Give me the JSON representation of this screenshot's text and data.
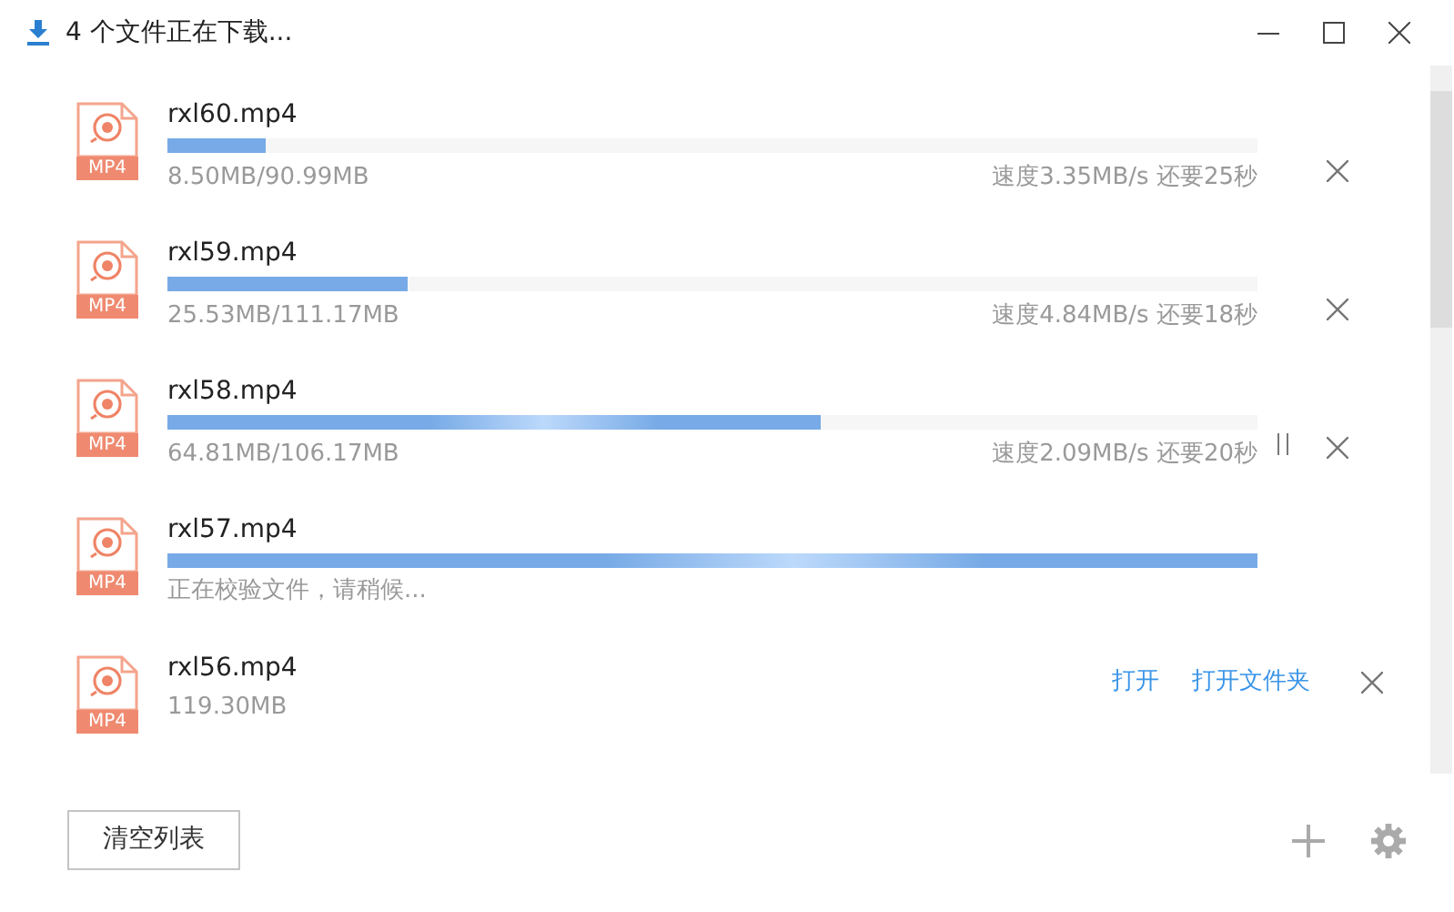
{
  "window": {
    "title": "4 个文件正在下载..."
  },
  "downloads": [
    {
      "kind": "downloading",
      "name": "rxl60.mp4",
      "badge": "MP4",
      "level": 0.09,
      "size": "8.50MB/90.99MB",
      "speed": "速度3.35MB/s 还要25秒",
      "shimmer": false,
      "pause_shown": false
    },
    {
      "kind": "downloading",
      "name": "rxl59.mp4",
      "badge": "MP4",
      "level": 0.22,
      "size": "25.53MB/111.17MB",
      "speed": "速度4.84MB/s 还要18秒",
      "shimmer": false,
      "pause_shown": false
    },
    {
      "kind": "downloading",
      "name": "rxl58.mp4",
      "badge": "MP4",
      "level": 0.6,
      "size": "64.81MB/106.17MB",
      "speed": "速度2.09MB/s 还要20秒",
      "shimmer": true,
      "pause_shown": true
    },
    {
      "kind": "verifying",
      "name": "rxl57.mp4",
      "badge": "MP4",
      "status": "正在校验文件，请稍候...",
      "shimmer": true
    },
    {
      "kind": "done",
      "name": "rxl56.mp4",
      "badge": "MP4",
      "size": "119.30MB",
      "open": "打开",
      "open_folder": "打开文件夹"
    }
  ],
  "footer": {
    "clear_button": "清空列表"
  }
}
